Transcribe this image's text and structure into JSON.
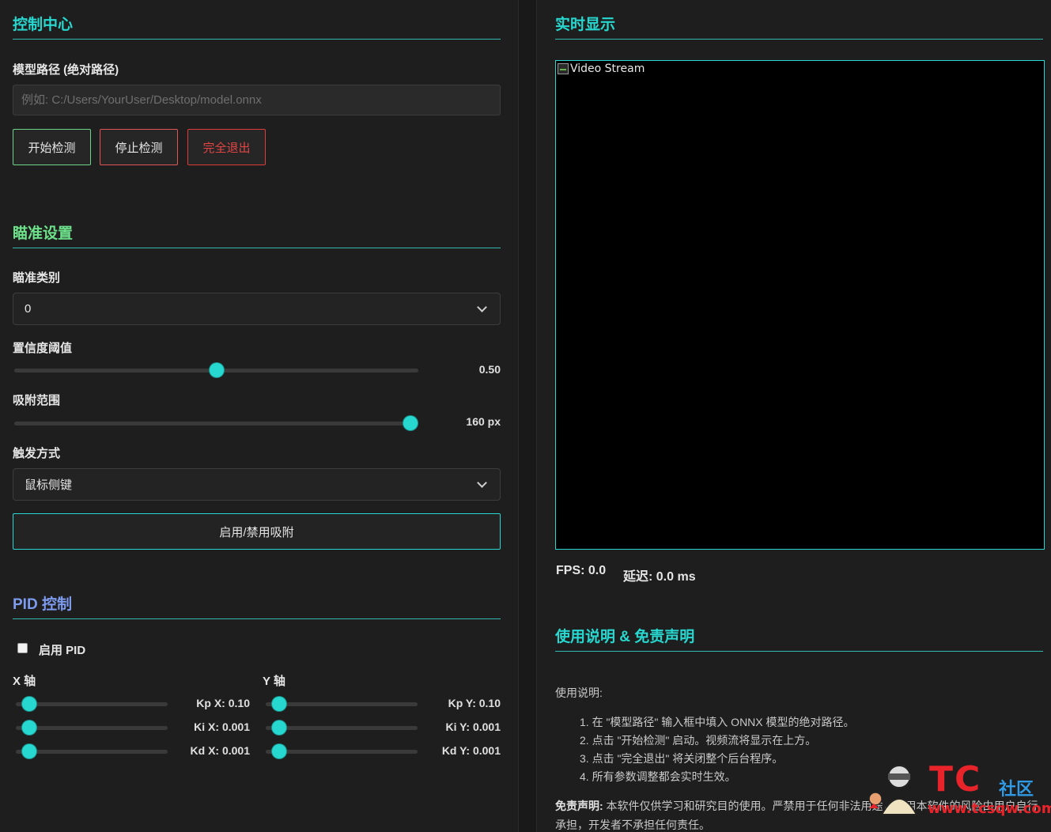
{
  "control": {
    "title": "控制中心",
    "model_path_label": "模型路径 (绝对路径)",
    "model_path_placeholder": "例如: C:/Users/YourUser/Desktop/model.onnx",
    "model_path_value": "",
    "start_label": "开始检测",
    "stop_label": "停止检测",
    "exit_label": "完全退出"
  },
  "aim": {
    "title": "瞄准设置",
    "category_label": "瞄准类别",
    "category_value": "0",
    "confidence_label": "置信度阈值",
    "confidence_value": 0.5,
    "confidence_text": "0.50",
    "range_label": "吸附范围",
    "range_value": 160,
    "range_max": 160,
    "range_text": "160 px",
    "trigger_label": "触发方式",
    "trigger_value": "鼠标侧键",
    "toggle_label": "启用/禁用吸附"
  },
  "pid": {
    "title": "PID 控制",
    "enable_label": "启用 PID",
    "enabled": false,
    "x_axis_label": "X 轴",
    "y_axis_label": "Y 轴",
    "x": [
      {
        "text": "Kp X: 0.10",
        "fraction": 0.0
      },
      {
        "text": "Ki X: 0.001",
        "fraction": 0.0
      },
      {
        "text": "Kd X: 0.001",
        "fraction": 0.0
      }
    ],
    "y": [
      {
        "text": "Kp Y: 0.10",
        "fraction": 0.0
      },
      {
        "text": "Ki Y: 0.001",
        "fraction": 0.0
      },
      {
        "text": "Kd Y: 0.001",
        "fraction": 0.0
      }
    ]
  },
  "display": {
    "title": "实时显示",
    "video_alt": "Video Stream",
    "fps_text": "FPS: 0.0",
    "latency_text": "延迟: 0.0 ms"
  },
  "help": {
    "title": "使用说明 & 免责声明",
    "usage_title": "使用说明:",
    "steps": [
      "1. 在 \"模型路径\" 输入框中填入 ONNX 模型的绝对路径。",
      "2. 点击 \"开始检测\" 启动。视频流将显示在上方。",
      "3. 点击 \"完全退出\" 将关闭整个后台程序。",
      "4. 所有参数调整都会实时生效。"
    ],
    "disclaimer_label": "免责声明:",
    "disclaimer_text": " 本软件仅供学习和研究目的使用。严禁用于任何非法用途，使用本软件的风险由用户自行承担，开发者不承担任何责任。"
  },
  "watermark": {
    "brand": "TC",
    "sub": "社区",
    "url": "www.tcsqw.com"
  },
  "colors": {
    "accent": "#27d8d0",
    "start_border": "#6dd58a",
    "stop_border": "#e05555",
    "exit": "#e03b3b"
  }
}
